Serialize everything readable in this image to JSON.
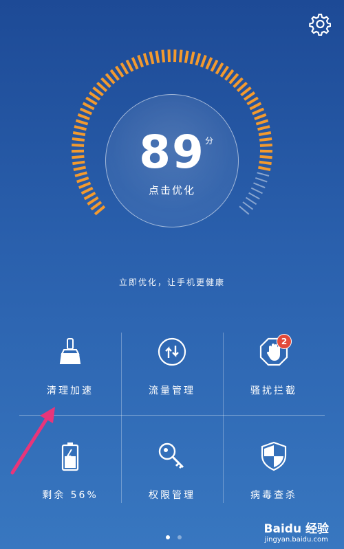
{
  "header": {
    "settings_icon": "gear-icon"
  },
  "score": {
    "value": "89",
    "unit": "分",
    "action": "点击优化",
    "progress": 0.89
  },
  "tagline": "立即优化，让手机更健康",
  "tiles": [
    {
      "icon": "broom-icon",
      "label": "清理加速"
    },
    {
      "icon": "traffic-arrows-icon",
      "label": "流量管理"
    },
    {
      "icon": "hand-block-icon",
      "label": "骚扰拦截",
      "badge": "2"
    },
    {
      "icon": "battery-icon",
      "label": "剩余 56%"
    },
    {
      "icon": "key-icon",
      "label": "权限管理"
    },
    {
      "icon": "shield-icon",
      "label": "病毒查杀"
    }
  ],
  "pager": {
    "pages": 2,
    "active": 0
  },
  "watermark": {
    "brand": "Baidu 经验",
    "url": "jingyan.baidu.com"
  },
  "colors": {
    "accent": "#f39a2e",
    "badge": "#e24a3a",
    "background": "#2a60ad"
  }
}
